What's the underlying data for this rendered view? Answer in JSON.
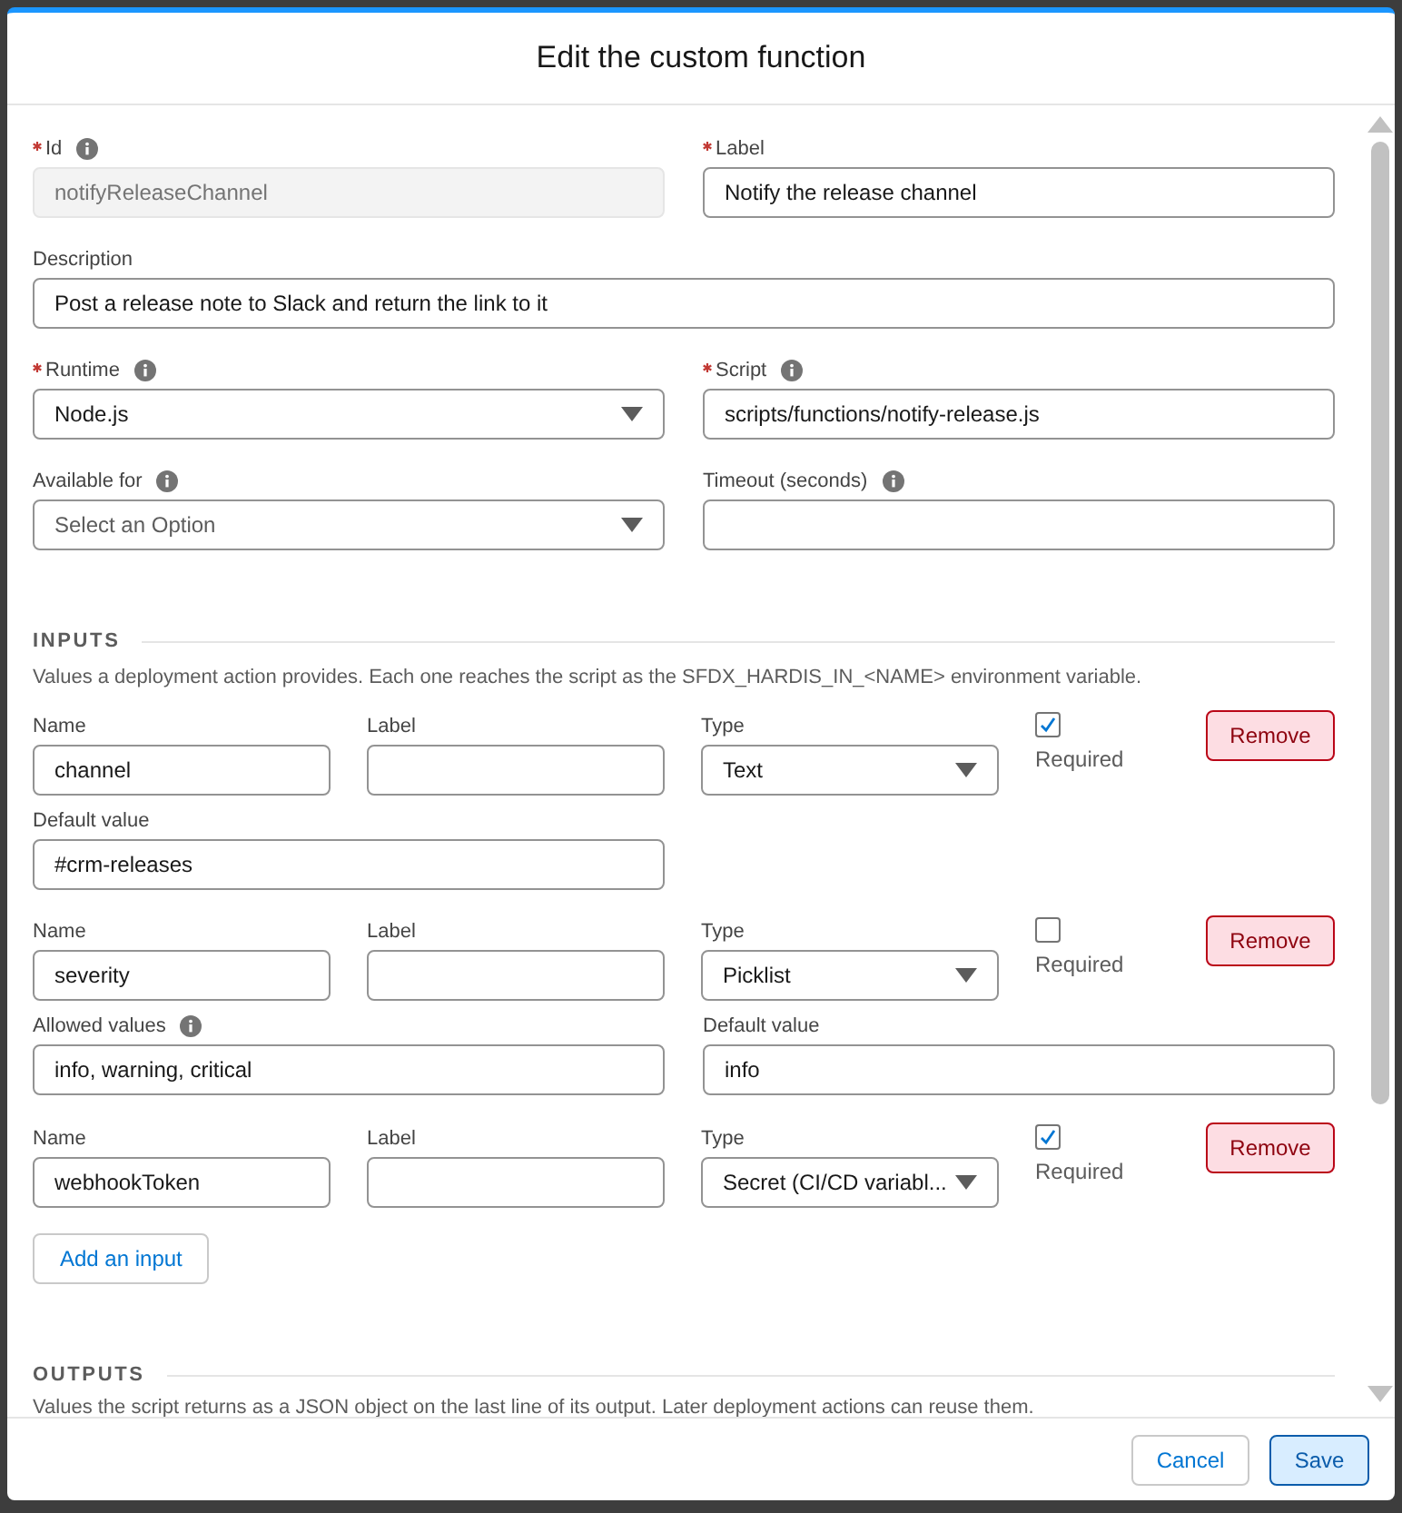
{
  "dialog": {
    "title": "Edit the custom function"
  },
  "rows": [
    [
      {
        "label": "Id",
        "required": true,
        "info": true,
        "kind": "text",
        "value": "notifyReleaseChannel",
        "disabled": true
      },
      {
        "label": "Label",
        "required": true,
        "kind": "text",
        "value": "Notify the release channel"
      }
    ],
    [
      {
        "label": "Description",
        "kind": "text",
        "value": "Post a release note to Slack and return the link to it"
      }
    ],
    [
      {
        "label": "Runtime",
        "required": true,
        "info": true,
        "kind": "select",
        "value": "Node.js"
      },
      {
        "label": "Script",
        "required": true,
        "info": true,
        "kind": "text",
        "value": "scripts/functions/notify-release.js"
      }
    ],
    [
      {
        "label": "Available for",
        "info": true,
        "kind": "select",
        "placeholder": "Select an Option"
      },
      {
        "label": "Timeout (seconds)",
        "info": true,
        "kind": "text"
      }
    ]
  ],
  "inputs": {
    "heading": "INPUTS",
    "description": "Values a deployment action provides. Each one reaches the script as the SFDX_HARDIS_IN_<NAME> environment variable.",
    "items": [
      {
        "name_label": "Name",
        "name": "channel",
        "label_label": "Label",
        "type_label": "Type",
        "type": "Text",
        "required": true,
        "required_label": "Required",
        "remove": "Remove",
        "extra": [
          {
            "label": "Default value",
            "value": "#crm-releases"
          }
        ]
      },
      {
        "name_label": "Name",
        "name": "severity",
        "label_label": "Label",
        "type_label": "Type",
        "type": "Picklist",
        "required": false,
        "required_label": "Required",
        "remove": "Remove",
        "extra": [
          {
            "label": "Allowed values",
            "info": true,
            "value": "info, warning, critical"
          },
          {
            "label": "Default value",
            "value": "info"
          }
        ]
      },
      {
        "name_label": "Name",
        "name": "webhookToken",
        "label_label": "Label",
        "type_label": "Type",
        "type": "Secret (CI/CD variabl...",
        "required": true,
        "required_label": "Required",
        "remove": "Remove"
      }
    ],
    "add_button": "Add an input"
  },
  "outputs": {
    "heading": "OUTPUTS",
    "description": "Values the script returns as a JSON object on the last line of its output. Later deployment actions can reuse them."
  },
  "footer": [
    {
      "label": "Cancel",
      "kind": "secondary"
    },
    {
      "label": "Save",
      "kind": "primary"
    }
  ]
}
